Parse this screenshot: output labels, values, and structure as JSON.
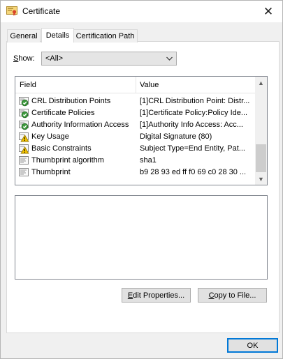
{
  "window": {
    "title": "Certificate"
  },
  "tabs": [
    {
      "label": "General"
    },
    {
      "label": "Details"
    },
    {
      "label": "Certification Path"
    }
  ],
  "show": {
    "label_prefix": "S",
    "label_rest": "how:",
    "selected": "<All>"
  },
  "columns": {
    "field": "Field",
    "value": "Value"
  },
  "rows": [
    {
      "field": "CRL Distribution Points",
      "value": "[1]CRL Distribution Point: Distr...",
      "icon": "green-check-certificate-icon"
    },
    {
      "field": "Certificate Policies",
      "value": "[1]Certificate Policy:Policy Ide...",
      "icon": "green-check-certificate-icon"
    },
    {
      "field": "Authority Information Access",
      "value": "[1]Authority Info Access: Acc...",
      "icon": "green-check-certificate-icon"
    },
    {
      "field": "Key Usage",
      "value": "Digital Signature (80)",
      "icon": "warning-certificate-icon"
    },
    {
      "field": "Basic Constraints",
      "value": "Subject Type=End Entity, Pat...",
      "icon": "warning-certificate-icon"
    },
    {
      "field": "Thumbprint algorithm",
      "value": "sha1",
      "icon": "certificate-icon"
    },
    {
      "field": "Thumbprint",
      "value": "b9 28 93 ed ff f0 69 c0 28 30 ...",
      "icon": "certificate-icon"
    }
  ],
  "buttons": {
    "edit_prefix": "E",
    "edit_rest": "dit Properties...",
    "copy_prefix": "C",
    "copy_rest": "opy to File...",
    "ok": "OK"
  },
  "colors": {
    "accent": "#0078d7",
    "window_bg": "#f0f0f0"
  }
}
